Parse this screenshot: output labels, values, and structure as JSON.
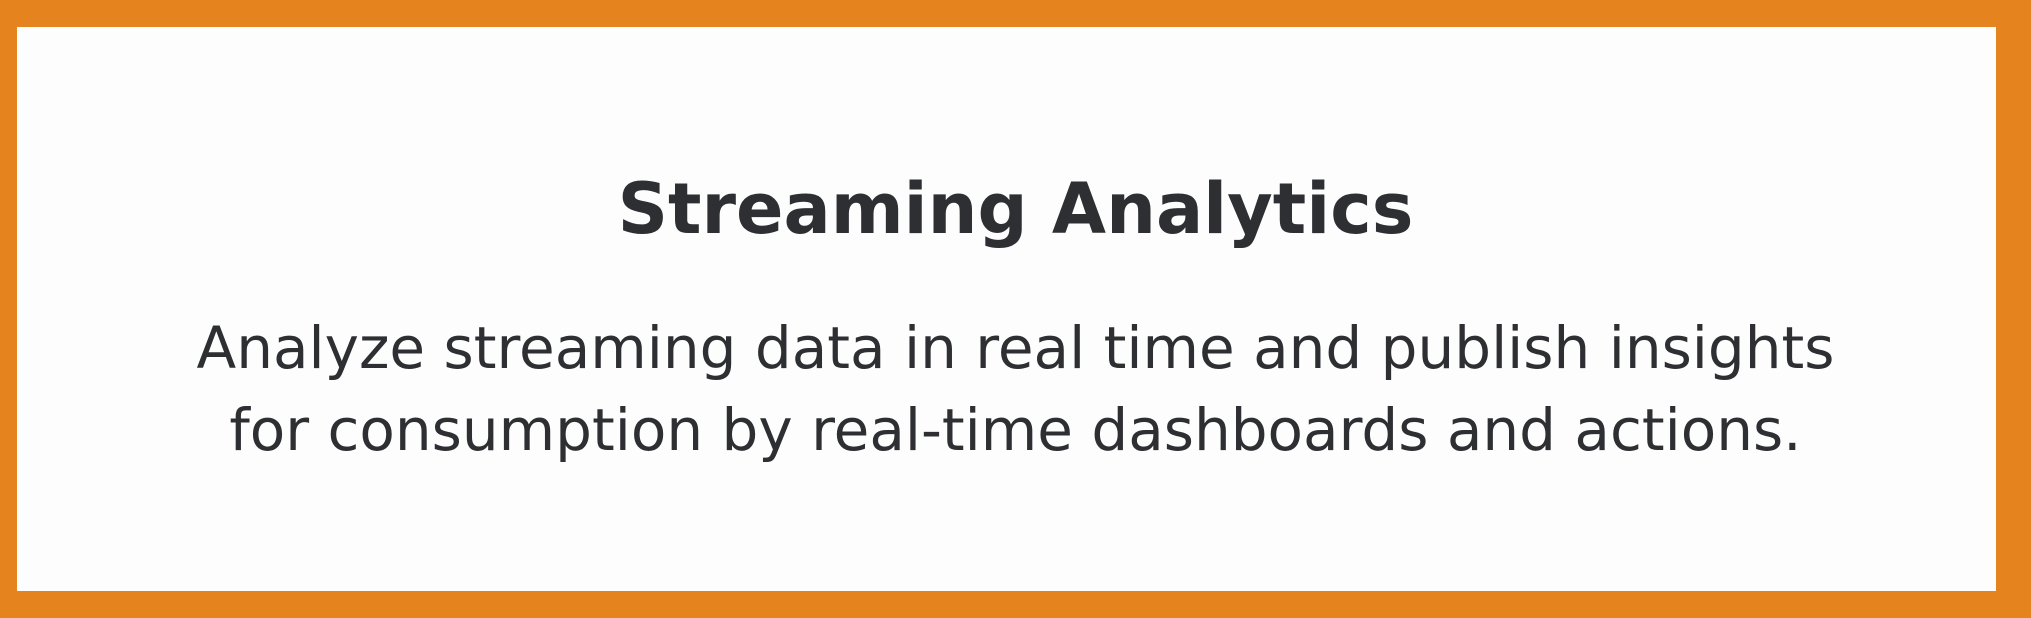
{
  "card": {
    "title": "Streaming Analytics",
    "description_lines": [
      "Analyze streaming data in real time and publish insights",
      "for consumption by real-time dashboards and actions."
    ]
  },
  "colors": {
    "border": "#e5831f",
    "background": "#fdfdfd",
    "text": "#2e2f33"
  }
}
